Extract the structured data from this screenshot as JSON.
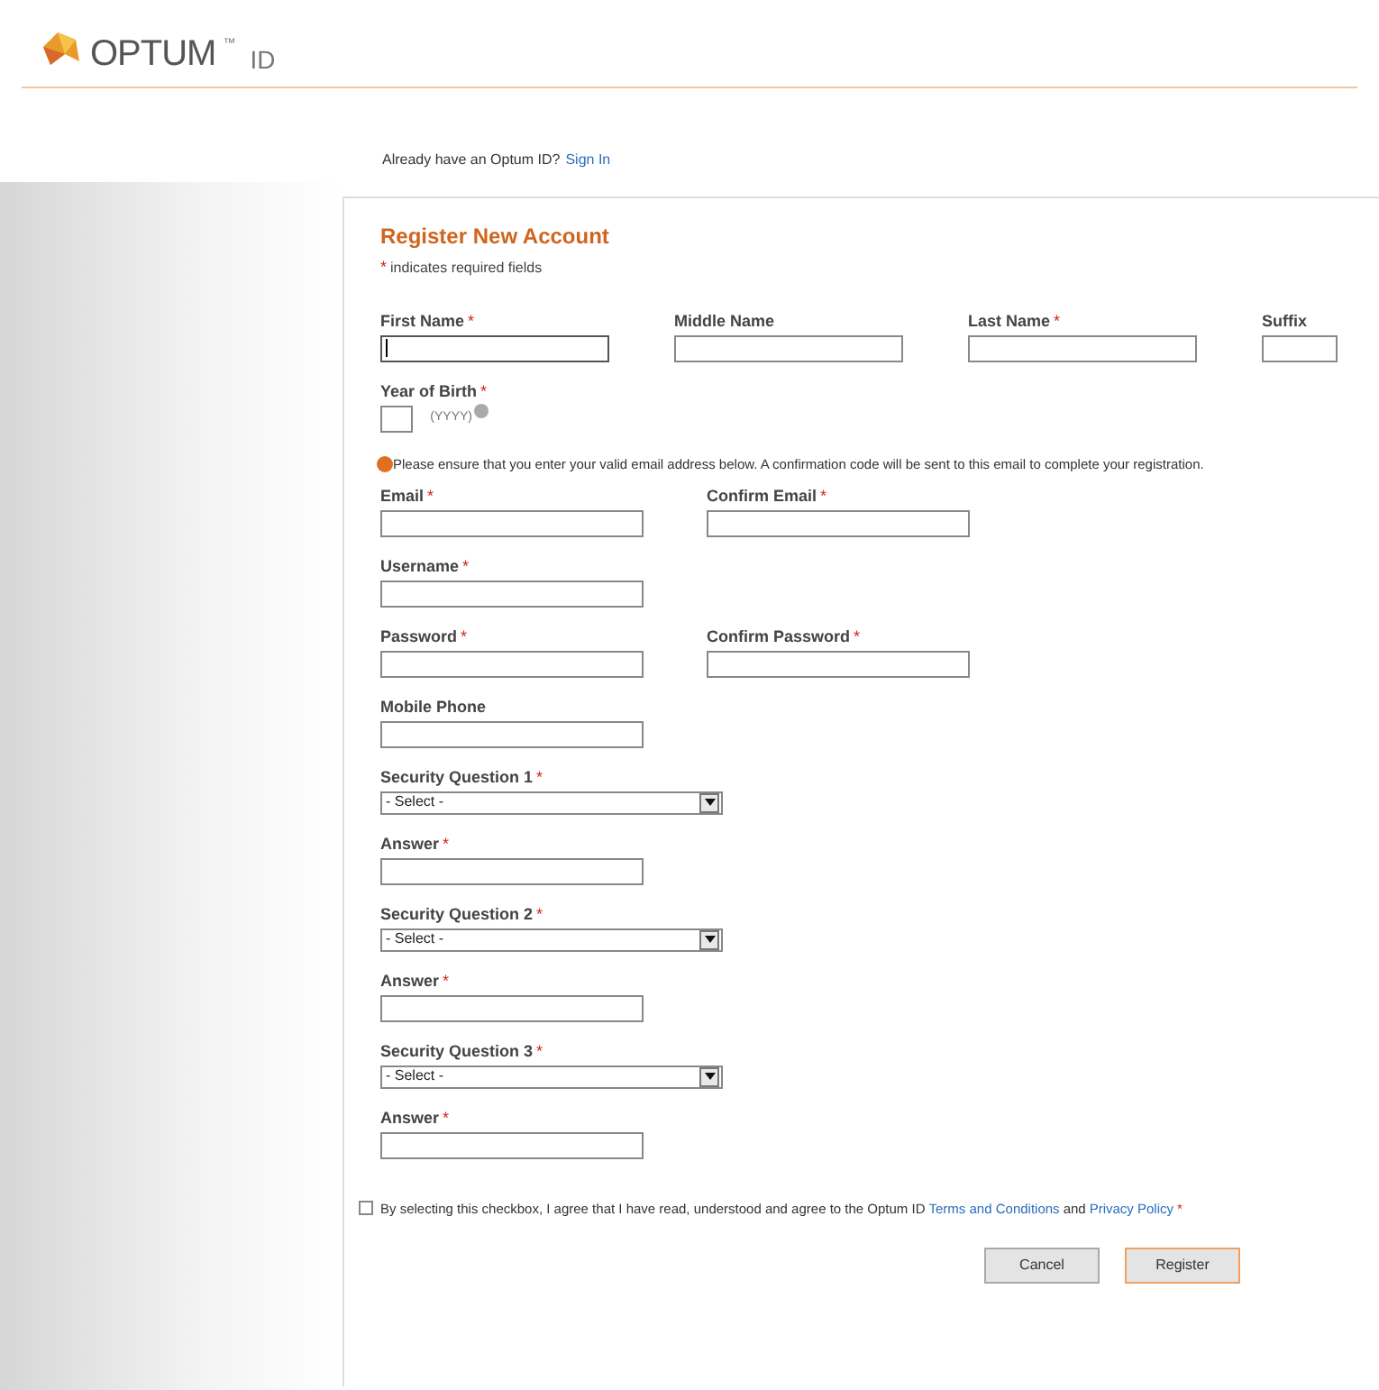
{
  "header": {
    "logo_text": "OPTUM",
    "trademark": "™",
    "product": "ID"
  },
  "signin_prompt": {
    "text": "Already have an Optum ID?",
    "link": "Sign In"
  },
  "form": {
    "title": "Register New Account",
    "required_note": {
      "mark": "*",
      "text": "indicates required fields"
    },
    "rows": [
      {
        "kind": "fields",
        "fields": [
          {
            "kind": "name",
            "label": "First Name",
            "required_mark": "*",
            "focused": true
          },
          {
            "kind": "name",
            "label": "Middle Name",
            "focused": false
          },
          {
            "kind": "name",
            "label": "Last Name",
            "required_mark": "*",
            "focused": false
          },
          {
            "kind": "suffix",
            "label": "Suffix",
            "focused": false
          }
        ]
      },
      {
        "kind": "fields",
        "fields": [
          {
            "kind": "year",
            "label": "Year of Birth",
            "required_mark": "*",
            "hint": "(YYYY)",
            "focused": false
          }
        ]
      },
      {
        "kind": "notice",
        "text": "Please ensure that you enter your valid email address below. A confirmation code will be sent to this email to complete your registration."
      },
      {
        "kind": "fields",
        "fields": [
          {
            "kind": "text",
            "label": "Email",
            "required_mark": "*",
            "focused": false
          },
          {
            "kind": "text",
            "label": "Confirm Email",
            "required_mark": "*",
            "focused": false
          }
        ]
      },
      {
        "kind": "fields",
        "fields": [
          {
            "kind": "text",
            "label": "Username",
            "required_mark": "*",
            "focused": false
          }
        ]
      },
      {
        "kind": "fields",
        "fields": [
          {
            "kind": "text",
            "label": "Password",
            "required_mark": "*",
            "focused": false
          },
          {
            "kind": "text",
            "label": "Confirm Password",
            "required_mark": "*",
            "focused": false
          }
        ]
      },
      {
        "kind": "fields",
        "fields": [
          {
            "kind": "text",
            "label": "Mobile Phone",
            "focused": false
          }
        ]
      },
      {
        "kind": "fields",
        "fields": [
          {
            "kind": "select",
            "label": "Security Question 1",
            "required_mark": "*",
            "value": "- Select -"
          }
        ]
      },
      {
        "kind": "fields",
        "fields": [
          {
            "kind": "text",
            "label": "Answer",
            "required_mark": "*",
            "focused": false
          }
        ]
      },
      {
        "kind": "fields",
        "fields": [
          {
            "kind": "select",
            "label": "Security Question 2",
            "required_mark": "*",
            "value": "- Select -"
          }
        ]
      },
      {
        "kind": "fields",
        "fields": [
          {
            "kind": "text",
            "label": "Answer",
            "required_mark": "*",
            "focused": false
          }
        ]
      },
      {
        "kind": "fields",
        "fields": [
          {
            "kind": "select",
            "label": "Security Question 3",
            "required_mark": "*",
            "value": "- Select -"
          }
        ]
      },
      {
        "kind": "fields",
        "fields": [
          {
            "kind": "text",
            "label": "Answer",
            "required_mark": "*",
            "focused": false
          }
        ]
      }
    ],
    "agreement": {
      "checked": false,
      "text": "By selecting this checkbox, I agree that I have read, understood and agree to the Optum ID",
      "link_1": "Terms and Conditions",
      "joiner": "and",
      "link_2": "Privacy Policy",
      "required_mark": "*"
    },
    "buttons": [
      {
        "label": "Cancel",
        "kind": "secondary"
      },
      {
        "label": "Register",
        "kind": "primary"
      }
    ]
  }
}
